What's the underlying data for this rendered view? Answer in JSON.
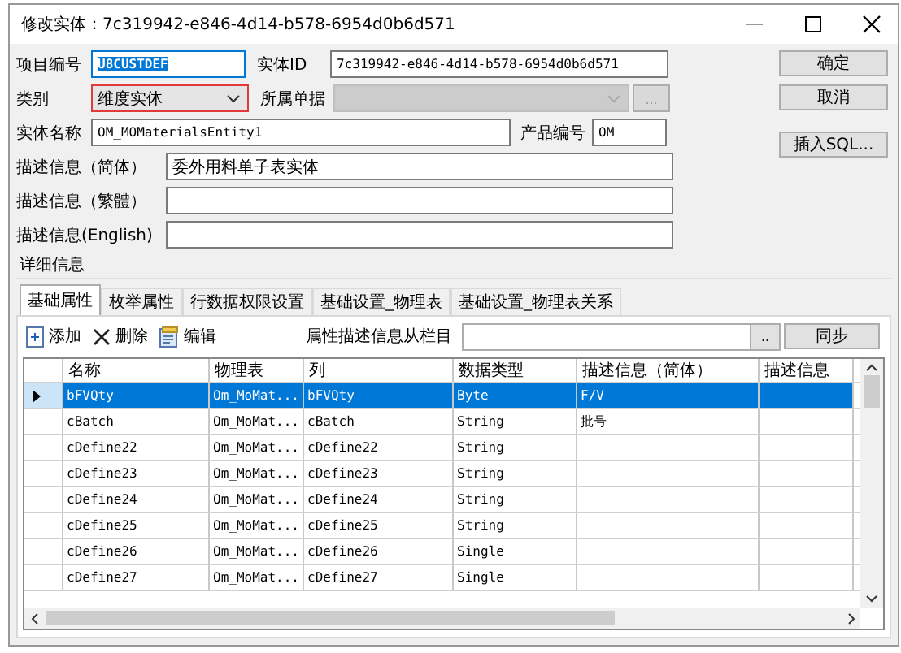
{
  "window": {
    "title": "修改实体：7c319942-e846-4d14-b578-6954d0b6d571"
  },
  "form": {
    "project_code": {
      "label": "项目编号",
      "value": "U8CUSTDEF",
      "text_selected": true
    },
    "entity_id": {
      "label": "实体ID",
      "value": "7c319942-e846-4d14-b578-6954d0b6d571"
    },
    "category": {
      "label": "类别",
      "value": "维度实体",
      "highlighted": true
    },
    "document": {
      "label": "所属单据",
      "disabled": true,
      "browse": "..."
    },
    "entity_name": {
      "label": "实体名称",
      "value": "OM_MOMaterialsEntity1"
    },
    "product_code": {
      "label": "产品编号",
      "value": "OM"
    },
    "descriptions": [
      {
        "label": "描述信息（简体）",
        "value": "委外用料单子表实体"
      },
      {
        "label": "描述信息（繁體）"
      },
      {
        "label": "描述信息(English)"
      }
    ]
  },
  "buttons": [
    "确定",
    "取消",
    "插入SQL..."
  ],
  "details": {
    "title": "详细信息",
    "tabs": [
      {
        "label": "基础属性",
        "selected": true
      },
      {
        "label": "枚举属性",
        "selected": false
      },
      {
        "label": "行数据权限设置",
        "selected": false
      },
      {
        "label": "基础设置_物理表",
        "selected": false
      },
      {
        "label": "基础设置_物理表关系",
        "selected": false
      }
    ],
    "toolbar": [
      {
        "kind": "add",
        "label": "添加"
      },
      {
        "kind": "delete",
        "label": "删除"
      },
      {
        "kind": "edit",
        "label": "编辑"
      }
    ],
    "sync_label": "属性描述信息从栏目",
    "sync_browse": "..",
    "sync_button": "同步",
    "table": {
      "columns": [
        "名称",
        "物理表",
        "列",
        "数据类型",
        "描述信息（简体）",
        "描述信息"
      ],
      "rows": [
        {
          "selected": true,
          "cells": [
            "bFVQty",
            "Om_MoMat...",
            "bFVQty",
            "Byte",
            "F/V",
            ""
          ]
        },
        {
          "selected": false,
          "cells": [
            "cBatch",
            "Om_MoMat...",
            "cBatch",
            "String",
            "批号",
            ""
          ]
        },
        {
          "selected": false,
          "cells": [
            "cDefine22",
            "Om_MoMat...",
            "cDefine22",
            "String",
            "",
            ""
          ]
        },
        {
          "selected": false,
          "cells": [
            "cDefine23",
            "Om_MoMat...",
            "cDefine23",
            "String",
            "",
            ""
          ]
        },
        {
          "selected": false,
          "cells": [
            "cDefine24",
            "Om_MoMat...",
            "cDefine24",
            "String",
            "",
            ""
          ]
        },
        {
          "selected": false,
          "cells": [
            "cDefine25",
            "Om_MoMat...",
            "cDefine25",
            "String",
            "",
            ""
          ]
        },
        {
          "selected": false,
          "cells": [
            "cDefine26",
            "Om_MoMat...",
            "cDefine26",
            "Single",
            "",
            ""
          ]
        },
        {
          "selected": false,
          "cells": [
            "cDefine27",
            "Om_MoMat...",
            "cDefine27",
            "Single",
            "",
            ""
          ]
        }
      ]
    }
  }
}
